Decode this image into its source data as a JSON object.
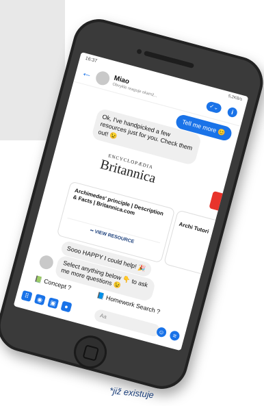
{
  "status": {
    "time": "16:37",
    "right": "5,2KB/s"
  },
  "header": {
    "name": "Miao",
    "subtitle": "Obvykle reaguje okamž...",
    "back_icon": "arrow-left-icon",
    "info_label": "i"
  },
  "messages": {
    "user": "Tell me more 😊",
    "bot1": "Ok, I've handpicked a few resources just for you. Check them out! 😉",
    "brand_top": "ENCYCLOPÆDIA",
    "brand_main": "Britannica",
    "card_title": "Archimedes' principle | Description & Facts | Britannica.com",
    "card_button": "•• VIEW RESOURCE",
    "card2_title": "Archi Tutori",
    "bot2": "Sooo HAPPY I could help! 🎉",
    "bot3": "Select anything below 👇 to ask me more questions 😉"
  },
  "quick_replies": {
    "concept": "Concept ?",
    "homework": "Homework Search ?"
  },
  "composer": {
    "placeholder": "Aa"
  },
  "caption": "*již existuje"
}
